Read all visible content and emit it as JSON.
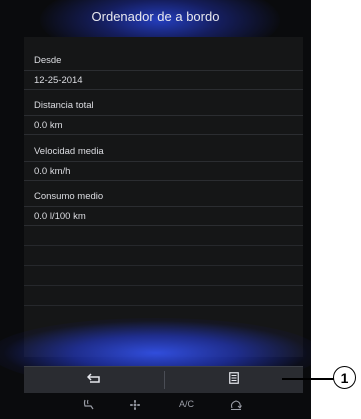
{
  "screen": {
    "title": "Ordenador de a bordo"
  },
  "rows": [
    {
      "label": "Desde",
      "value": "12-25-2014"
    },
    {
      "label": "Distancia total",
      "value": "0.0 km"
    },
    {
      "label": "Velocidad media",
      "value": "0.0 km/h"
    },
    {
      "label": "Consumo medio",
      "value": "0.0 l/100 km"
    }
  ],
  "bottom_buttons": [
    {
      "icon": "back-arrow-icon"
    },
    {
      "icon": "list-menu-icon"
    }
  ],
  "status_bar": {
    "items": [
      {
        "icon": "seat-heat-icon"
      },
      {
        "icon": "fan-icon"
      },
      {
        "label": "A/C"
      },
      {
        "icon": "recirculation-icon"
      }
    ]
  },
  "callout": {
    "number": "1"
  },
  "colors": {
    "glow": "#2a46d6",
    "background": "#0a0b0d",
    "panel": "#151617"
  }
}
